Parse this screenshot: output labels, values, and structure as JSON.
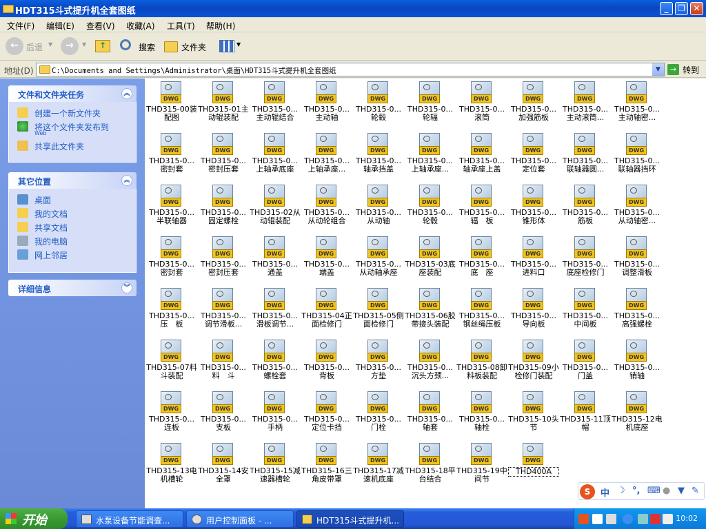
{
  "window": {
    "title": "HDT315斗式提升机全套图纸"
  },
  "menu": [
    "文件(F)",
    "编辑(E)",
    "查看(V)",
    "收藏(A)",
    "工具(T)",
    "帮助(H)"
  ],
  "toolbar": {
    "back": "后退",
    "search": "搜索",
    "folders": "文件夹"
  },
  "address": {
    "label": "地址(D)",
    "path": "C:\\Documents and Settings\\Administrator\\桌面\\HDT315斗式提升机全套图纸",
    "go": "转到"
  },
  "sidebar": {
    "tasks": {
      "title": "文件和文件夹任务",
      "items": [
        {
          "label": "创建一个新文件夹"
        },
        {
          "label": "将这个文件夹发布到",
          "sub": "Web"
        },
        {
          "label": "共享此文件夹"
        }
      ]
    },
    "places": {
      "title": "其它位置",
      "items": [
        "桌面",
        "我的文档",
        "共享文档",
        "我的电脑",
        "网上邻居"
      ]
    },
    "details": {
      "title": "详细信息"
    }
  },
  "files": [
    "THD315-00装配图",
    "THD315-01主动辊装配",
    "THD315-0...主动辊结合",
    "THD315-0...主动轴",
    "THD315-0...轮毂",
    "THD315-0...轮辐",
    "THD315-0...滚筒",
    "THD315-0...加强筋板",
    "THD315-0...主动滚筒...",
    "THD315-0...主动轴密...",
    "THD315-0...密封套",
    "THD315-0...密封压套",
    "THD315-0...上轴承底座",
    "THD315-0...上轴承座...",
    "THD315-0...轴承挡盖",
    "THD315-0...上轴承座...",
    "THD315-0...轴承座上盖",
    "THD315-0...定位套",
    "THD315-0...联轴器圆...",
    "THD315-0...联轴器挡环",
    "THD315-0...半联轴器",
    "THD315-0...固定螺栓",
    "THD315-02从动辊装配",
    "THD315-0...从动轮组合",
    "THD315-0...从动轴",
    "THD315-0...轮毂",
    "THD315-0...辐　板",
    "THD315-0...锥形体",
    "THD315-0...筋板",
    "THD315-0...从动轴密...",
    "THD315-0...密封套",
    "THD315-0...密封压套",
    "THD315-0...通盖",
    "THD315-0...端盖",
    "THD315-0...从动轴承座",
    "THD315-03底座装配",
    "THD315-0...底　座",
    "THD315-0...进料口",
    "THD315-0...底座检修门",
    "THD315-0...调整滑板",
    "THD315-0...压　板",
    "THD315-0...调节滑板...",
    "THD315-0...滑板调节...",
    "THD315-04正面检修门",
    "THD315-05侧面检修门",
    "THD315-06胶带接头装配",
    "THD315-0...钢丝绳压板",
    "THD315-0...导向板",
    "THD315-0...中间板",
    "THD315-0...高强螺栓",
    "THD315-07料斗装配",
    "THD315-0...料　斗",
    "THD315-0...螺栓套",
    "THD315-0...背板",
    "THD315-0...方垫",
    "THD315-0...沉头方颈...",
    "THD315-08卸料板装配",
    "THD315-09小检修门装配",
    "THD315-0...门盖",
    "THD315-0...销轴",
    "THD315-0...连板",
    "THD315-0...支板",
    "THD315-0...手柄",
    "THD315-0...定位卡挡",
    "THD315-0...门栓",
    "THD315-0...轴套",
    "THD315-0...轴栓",
    "THD315-10头节",
    "THD315-11顶帽",
    "THD315-12电机底座",
    "THD315-13电机槽轮",
    "THD315-14安全罩",
    "THD315-15减速器槽轮",
    "THD315-16三角皮带罩",
    "THD315-17减速机底座",
    "THD315-18平台结合",
    "THD315-19中间节",
    "THD400A"
  ],
  "file_badge": "DWG",
  "taskbar": {
    "start": "开始",
    "tasks": [
      "水泵设备节能调查...",
      "用户控制面板 - ...",
      "HDT315斗式提升机..."
    ],
    "clock": "10:02"
  },
  "ime": {
    "logo": "S",
    "mode": "中"
  }
}
